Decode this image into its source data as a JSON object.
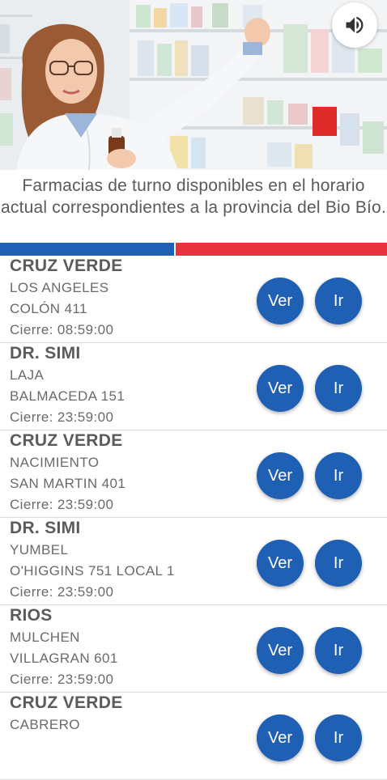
{
  "header": {
    "title": "Farmacias de turno disponibles en el horario actual correspondientes a la provincia del Bio Bío.",
    "sound_icon": "speaker-volume-icon"
  },
  "colors": {
    "blue": "#1f5fb4",
    "red": "#e8323d"
  },
  "pharmacies": [
    {
      "name": "CRUZ VERDE",
      "city": "LOS ANGELES",
      "address": "COLÓN 411",
      "close": "Cierre: 08:59:00",
      "ver": "Ver",
      "ir": "Ir"
    },
    {
      "name": "DR. SIMI",
      "city": "LAJA",
      "address": "BALMACEDA 151",
      "close": "Cierre: 23:59:00",
      "ver": "Ver",
      "ir": "Ir"
    },
    {
      "name": "CRUZ VERDE",
      "city": "NACIMIENTO",
      "address": "SAN MARTIN 401",
      "close": "Cierre: 23:59:00",
      "ver": "Ver",
      "ir": "Ir"
    },
    {
      "name": "DR. SIMI",
      "city": "YUMBEL",
      "address": "O'HIGGINS 751 LOCAL 1",
      "close": "Cierre: 23:59:00",
      "ver": "Ver",
      "ir": "Ir"
    },
    {
      "name": "RIOS",
      "city": "MULCHEN",
      "address": "VILLAGRAN 601",
      "close": "Cierre: 23:59:00",
      "ver": "Ver",
      "ir": "Ir"
    },
    {
      "name": "CRUZ VERDE",
      "city": "CABRERO",
      "address": "",
      "close": "",
      "ver": "Ver",
      "ir": "Ir"
    }
  ]
}
